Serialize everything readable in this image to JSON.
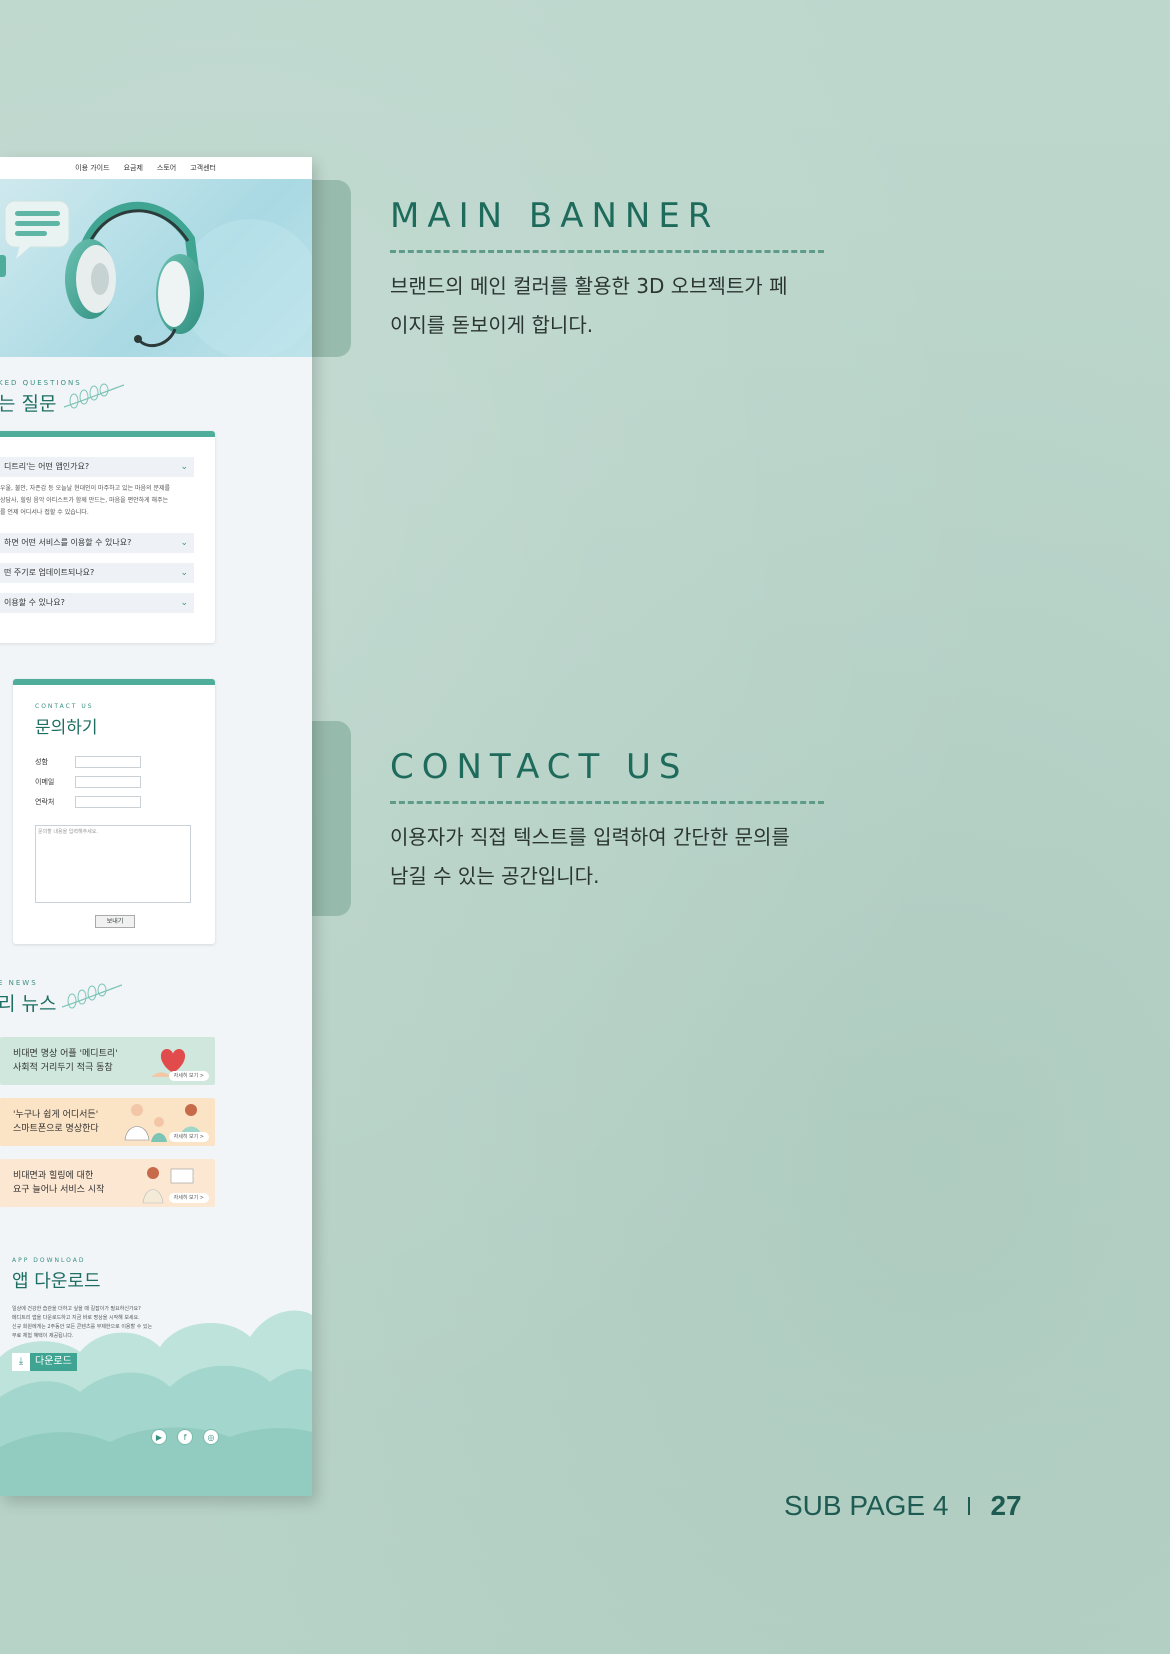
{
  "mockup": {
    "nav": [
      "이용 가이드",
      "요금제",
      "스토어",
      "고객센터"
    ],
    "faq": {
      "eyebrow": "KED QUESTIONS",
      "title": "는 질문",
      "questions": [
        {
          "q": "디트리'는 어떤 앱인가요?"
        },
        {
          "q": "하면 어떤 서비스를 이용할 수 있나요?"
        },
        {
          "q": "떤 주기로 업데이트되나요?"
        },
        {
          "q": "이용할 수 있나요?"
        }
      ],
      "answer_lines": [
        "우울, 불안, 자존감 등 오늘날 현대인이 마주하고 있는 마음의 문제를",
        "상담사, 힐링 음악 아티스트가 함께 만드는, 마음을 편안하게 해주는",
        "를 언제 어디서나 접할 수 있습니다."
      ]
    },
    "contact": {
      "eyebrow": "CONTACT US",
      "title": "문의하기",
      "fields": [
        "성함",
        "이메일",
        "연락처"
      ],
      "textarea_placeholder": "문의할 내용을 입력해주세요.",
      "send_label": "보내기"
    },
    "news": {
      "eyebrow": "E NEWS",
      "title": "리 뉴스",
      "items": [
        {
          "line1": "비대면 명상 어플 '메디트리'",
          "line2": "사회적 거리두기 적극 동참",
          "more": "자세히 보기 >",
          "color": "#cfe7dc"
        },
        {
          "line1": "'누구나 쉽게 어디서든'",
          "line2": "스마트폰으로 명상한다",
          "more": "자세히 보기 >",
          "color": "#fbe3c6"
        },
        {
          "line1": "비대면과 힐링에 대한",
          "line2": "요구 늘어나 서비스 시작",
          "more": "자세히 보기 >",
          "color": "#fbe7d2"
        }
      ]
    },
    "app": {
      "eyebrow": "APP DOWNLOAD",
      "title": "앱 다운로드",
      "desc_lines": [
        "일상에 건강한 습관을 더하고 싶을 때 길잡이가 필요하신가요?",
        "메디트리 앱을 다운로드하고 지금 바로 명상을 시작해 보세요.",
        "신규 회원에게는 2주동안 모든 콘텐츠를 무제한으로 이용할 수 있는",
        "무료 체험 혜택이 제공됩니다."
      ],
      "download_label": "다운로드",
      "download_icon": "download-icon"
    },
    "social_icons": [
      "youtube-icon",
      "facebook-icon",
      "instagram-icon"
    ]
  },
  "sections": [
    {
      "title": "MAIN BANNER",
      "desc_lines": [
        "브랜드의 메인 컬러를 활용한 3D 오브젝트가 페",
        "이지를 돋보이게 합니다."
      ]
    },
    {
      "title": "CONTACT US",
      "desc_lines": [
        "이용자가 직접 텍스트를 입력하여 간단한 문의를",
        "남길 수 있는 공간입니다."
      ]
    }
  ],
  "page_label": {
    "text": "SUB PAGE 4",
    "number": "27"
  },
  "colors": {
    "accent": "#1e6b5c",
    "mint": "#4fae9b",
    "background": "#bcd6cc"
  }
}
